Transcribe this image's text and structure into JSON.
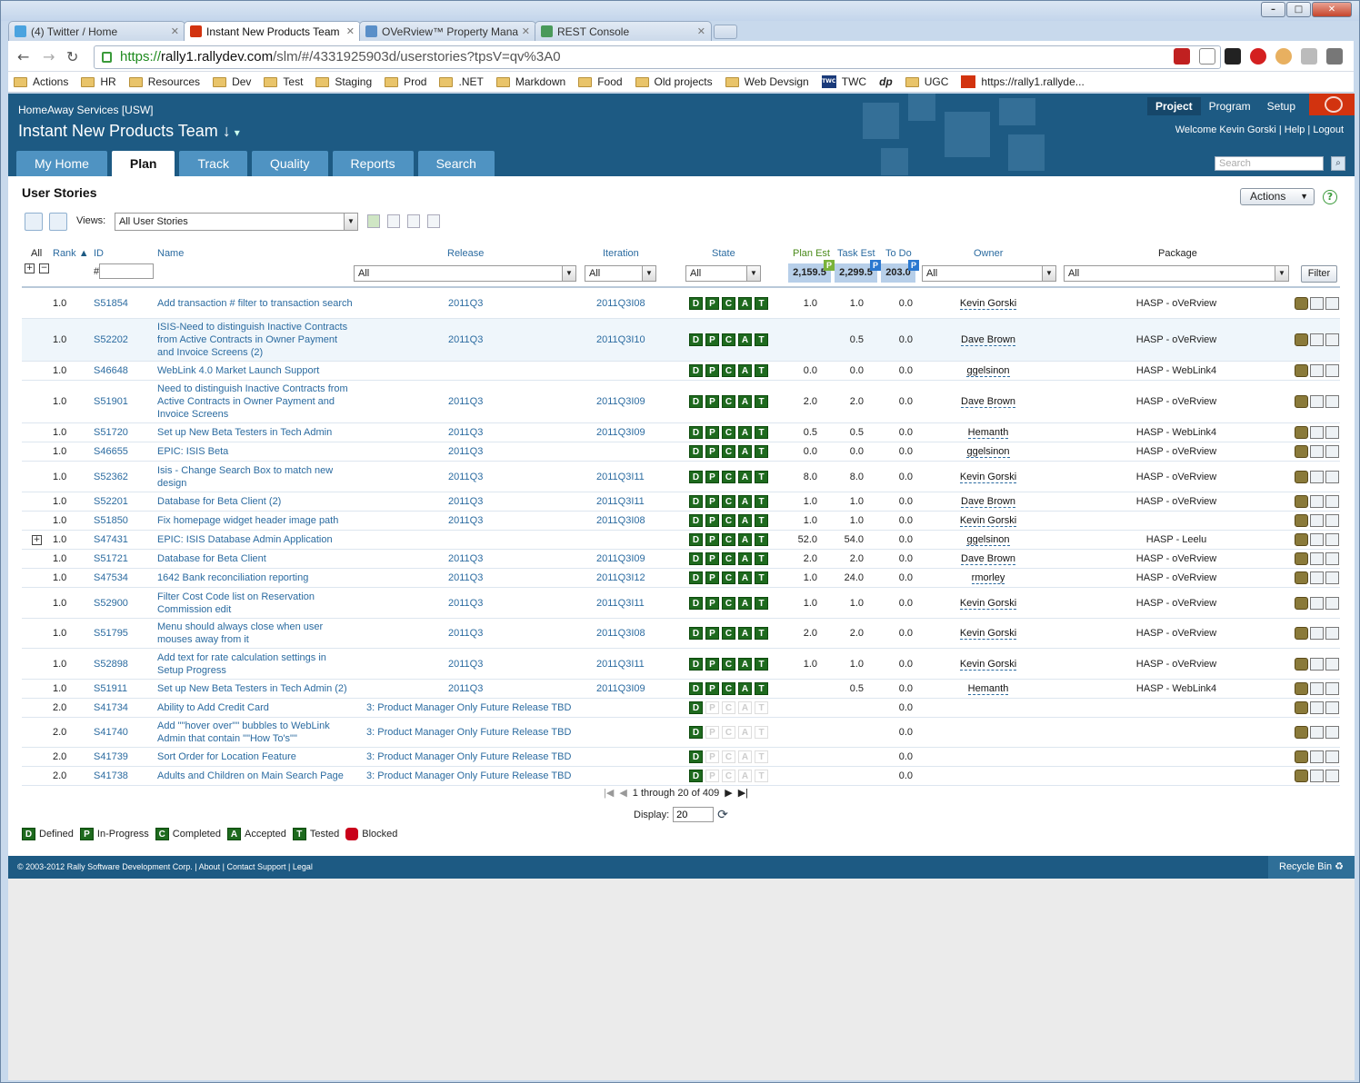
{
  "browser": {
    "tabs": [
      {
        "label": "(4) Twitter / Home",
        "icon": "twitter-icon",
        "active": false
      },
      {
        "label": "Instant New Products Team",
        "icon": "rally-icon",
        "active": true
      },
      {
        "label": "OVeRview™ Property Mana",
        "icon": "overview-icon",
        "active": false
      },
      {
        "label": "REST Console",
        "icon": "rest-icon",
        "active": false
      }
    ],
    "url_scheme": "https://",
    "url_host": "rally1.rallydev.com",
    "url_path": "/slm/#/4331925903d/userstories?tpsV=qv%3A0",
    "bookmarks": [
      {
        "label": "Actions",
        "type": "folder"
      },
      {
        "label": "HR",
        "type": "folder"
      },
      {
        "label": "Resources",
        "type": "folder"
      },
      {
        "label": "Dev",
        "type": "folder"
      },
      {
        "label": "Test",
        "type": "folder"
      },
      {
        "label": "Staging",
        "type": "folder"
      },
      {
        "label": "Prod",
        "type": "folder"
      },
      {
        "label": ".NET",
        "type": "folder"
      },
      {
        "label": "Markdown",
        "type": "folder"
      },
      {
        "label": "Food",
        "type": "folder"
      },
      {
        "label": "Old projects",
        "type": "folder"
      },
      {
        "label": "Web Devsign",
        "type": "folder"
      },
      {
        "label": "TWC",
        "type": "site",
        "icon_text": "TWC"
      },
      {
        "label": "dp",
        "type": "site"
      },
      {
        "label": "UGC",
        "type": "folder"
      },
      {
        "label": "https://rally1.rallyde...",
        "type": "site",
        "icon_text": ""
      }
    ]
  },
  "app": {
    "workspace": "HomeAway Services [USW]",
    "project": "Instant New Products Team",
    "project_suffix": "↓",
    "header_nav": [
      "Project",
      "Program",
      "Setup"
    ],
    "welcome": "Welcome Kevin Gorski | Help | Logout",
    "main_tabs": [
      "My Home",
      "Plan",
      "Track",
      "Quality",
      "Reports",
      "Search"
    ],
    "active_tab": "Plan",
    "search_placeholder": "Search",
    "page_title": "User Stories",
    "actions_label": "Actions",
    "views_label": "Views:",
    "view_selected": "All User Stories",
    "filter_button": "Filter",
    "id_hash": "#"
  },
  "grid": {
    "columns": {
      "all": "All",
      "rank": "Rank",
      "id": "ID",
      "name": "Name",
      "release": "Release",
      "iteration": "Iteration",
      "state": "State",
      "plan_est": "Plan Est",
      "task_est": "Task Est",
      "todo": "To Do",
      "owner": "Owner",
      "package": "Package"
    },
    "filters": {
      "release": "All",
      "iteration": "All",
      "state": "All",
      "owner": "All",
      "package": "All"
    },
    "totals": {
      "plan_est": "2,159.5",
      "task_est": "2,299.5",
      "todo": "203.0"
    },
    "total_badges": {
      "plan_est": "P",
      "task_est": "P",
      "todo": "P"
    },
    "rows": [
      {
        "rank": "1.0",
        "id": "S51854",
        "name": "Add transaction # filter to transaction search",
        "release": "2011Q3",
        "iteration": "2011Q3I08",
        "states": "DPCAT",
        "plan": "1.0",
        "task": "1.0",
        "todo": "0.0",
        "owner": "Kevin Gorski",
        "package": "HASP - oVeRview"
      },
      {
        "rank": "1.0",
        "id": "S52202",
        "name": "ISIS-Need to distinguish Inactive Contracts from Active Contracts in Owner Payment and Invoice Screens (2)",
        "release": "2011Q3",
        "iteration": "2011Q3I10",
        "states": "DPCAT",
        "plan": "",
        "task": "0.5",
        "todo": "0.0",
        "owner": "Dave Brown",
        "package": "HASP - oVeRview"
      },
      {
        "rank": "1.0",
        "id": "S46648",
        "name": "WebLink 4.0 Market Launch Support",
        "release": "",
        "iteration": "",
        "states": "DPCAT",
        "plan": "0.0",
        "task": "0.0",
        "todo": "0.0",
        "owner": "ggelsinon",
        "package": "HASP - WebLink4"
      },
      {
        "rank": "1.0",
        "id": "S51901",
        "name": "Need to distinguish Inactive Contracts from Active Contracts in Owner Payment and Invoice Screens",
        "release": "2011Q3",
        "iteration": "2011Q3I09",
        "states": "DPCAT",
        "plan": "2.0",
        "task": "2.0",
        "todo": "0.0",
        "owner": "Dave Brown",
        "package": "HASP - oVeRview"
      },
      {
        "rank": "1.0",
        "id": "S51720",
        "name": "Set up New Beta Testers in Tech Admin",
        "release": "2011Q3",
        "iteration": "2011Q3I09",
        "states": "DPCAT",
        "plan": "0.5",
        "task": "0.5",
        "todo": "0.0",
        "owner": "Hemanth",
        "package": "HASP - WebLink4"
      },
      {
        "rank": "1.0",
        "id": "S46655",
        "name": "EPIC: ISIS Beta",
        "release": "2011Q3",
        "iteration": "",
        "states": "DPCAT",
        "plan": "0.0",
        "task": "0.0",
        "todo": "0.0",
        "owner": "ggelsinon",
        "package": "HASP - oVeRview"
      },
      {
        "rank": "1.0",
        "id": "S52362",
        "name": "Isis - Change Search Box to match new design",
        "release": "2011Q3",
        "iteration": "2011Q3I11",
        "states": "DPCAT",
        "plan": "8.0",
        "task": "8.0",
        "todo": "0.0",
        "owner": "Kevin Gorski",
        "package": "HASP - oVeRview"
      },
      {
        "rank": "1.0",
        "id": "S52201",
        "name": "Database for Beta Client (2)",
        "release": "2011Q3",
        "iteration": "2011Q3I11",
        "states": "DPCAT",
        "plan": "1.0",
        "task": "1.0",
        "todo": "0.0",
        "owner": "Dave Brown",
        "package": "HASP - oVeRview"
      },
      {
        "rank": "1.0",
        "id": "S51850",
        "name": "Fix homepage widget header image path",
        "release": "2011Q3",
        "iteration": "2011Q3I08",
        "states": "DPCAT",
        "plan": "1.0",
        "task": "1.0",
        "todo": "0.0",
        "owner": "Kevin Gorski",
        "package": ""
      },
      {
        "rank": "1.0",
        "id": "S47431",
        "name": "EPIC: ISIS Database Admin Application",
        "release": "",
        "iteration": "",
        "states": "DPCAT",
        "plan": "52.0",
        "task": "54.0",
        "todo": "0.0",
        "owner": "ggelsinon",
        "package": "HASP - Leelu",
        "expander": "+"
      },
      {
        "rank": "1.0",
        "id": "S51721",
        "name": "Database for Beta Client",
        "release": "2011Q3",
        "iteration": "2011Q3I09",
        "states": "DPCAT",
        "plan": "2.0",
        "task": "2.0",
        "todo": "0.0",
        "owner": "Dave Brown",
        "package": "HASP - oVeRview"
      },
      {
        "rank": "1.0",
        "id": "S47534",
        "name": "1642 Bank reconciliation reporting",
        "release": "2011Q3",
        "iteration": "2011Q3I12",
        "states": "DPCAT",
        "plan": "1.0",
        "task": "24.0",
        "todo": "0.0",
        "owner": "rmorley",
        "package": "HASP - oVeRview"
      },
      {
        "rank": "1.0",
        "id": "S52900",
        "name": "Filter Cost Code list on Reservation Commission edit",
        "release": "2011Q3",
        "iteration": "2011Q3I11",
        "states": "DPCAT",
        "plan": "1.0",
        "task": "1.0",
        "todo": "0.0",
        "owner": "Kevin Gorski",
        "package": "HASP - oVeRview"
      },
      {
        "rank": "1.0",
        "id": "S51795",
        "name": "Menu should always close when user mouses away from it",
        "release": "2011Q3",
        "iteration": "2011Q3I08",
        "states": "DPCAT",
        "plan": "2.0",
        "task": "2.0",
        "todo": "0.0",
        "owner": "Kevin Gorski",
        "package": "HASP - oVeRview"
      },
      {
        "rank": "1.0",
        "id": "S52898",
        "name": "Add text for rate calculation settings in Setup Progress",
        "release": "2011Q3",
        "iteration": "2011Q3I11",
        "states": "DPCAT",
        "plan": "1.0",
        "task": "1.0",
        "todo": "0.0",
        "owner": "Kevin Gorski",
        "package": "HASP - oVeRview"
      },
      {
        "rank": "1.0",
        "id": "S51911",
        "name": "Set up New Beta Testers in Tech Admin (2)",
        "release": "2011Q3",
        "iteration": "2011Q3I09",
        "states": "DPCAT",
        "plan": "",
        "task": "0.5",
        "todo": "0.0",
        "owner": "Hemanth",
        "package": "HASP - WebLink4"
      },
      {
        "rank": "2.0",
        "id": "S41734",
        "name": "Ability to Add Credit Card",
        "release": "3: Product Manager Only Future Release TBD",
        "iteration": "",
        "states": "D",
        "plan": "",
        "task": "",
        "todo": "0.0",
        "owner": "",
        "package": ""
      },
      {
        "rank": "2.0",
        "id": "S41740",
        "name": "Add \"\"hover over\"\" bubbles to WebLink Admin that contain \"\"How To's\"\"",
        "release": "3: Product Manager Only Future Release TBD",
        "iteration": "",
        "states": "D",
        "plan": "",
        "task": "",
        "todo": "0.0",
        "owner": "",
        "package": ""
      },
      {
        "rank": "2.0",
        "id": "S41739",
        "name": "Sort Order for Location Feature",
        "release": "3: Product Manager Only Future Release TBD",
        "iteration": "",
        "states": "D",
        "plan": "",
        "task": "",
        "todo": "0.0",
        "owner": "",
        "package": ""
      },
      {
        "rank": "2.0",
        "id": "S41738",
        "name": "Adults and Children on Main Search Page",
        "release": "3: Product Manager Only Future Release TBD",
        "iteration": "",
        "states": "D",
        "plan": "",
        "task": "",
        "todo": "0.0",
        "owner": "",
        "package": ""
      }
    ],
    "pager_text": "1 through 20 of 409",
    "display_label": "Display:",
    "display_value": "20"
  },
  "legend": [
    {
      "letter": "D",
      "label": "Defined"
    },
    {
      "letter": "P",
      "label": "In-Progress"
    },
    {
      "letter": "C",
      "label": "Completed"
    },
    {
      "letter": "A",
      "label": "Accepted"
    },
    {
      "letter": "T",
      "label": "Tested"
    }
  ],
  "legend_blocked": "Blocked",
  "footer": {
    "copyright": "© 2003-2012 Rally Software Development Corp.",
    "links": [
      "About",
      "Contact Support",
      "Legal"
    ],
    "recycle": "Recycle Bin"
  },
  "colors": {
    "header": "#1d5a83",
    "tab": "#4f93c2",
    "state_on": "#1e6a1e",
    "link": "#2b6ba0",
    "blocked": "#c9001a"
  }
}
